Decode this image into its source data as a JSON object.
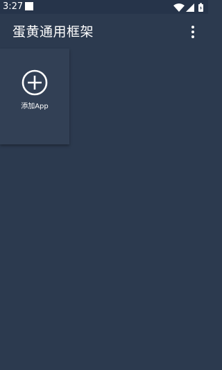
{
  "status_bar": {
    "time": "3:27",
    "icons": [
      "notification-square-icon",
      "wifi-icon",
      "signal-icon",
      "battery-charging-icon"
    ]
  },
  "app_bar": {
    "title": "蛋黄通用框架",
    "menu_icon": "more-vert-icon"
  },
  "main": {
    "add_app_card": {
      "icon": "add-circle-icon",
      "label": "添加App"
    }
  },
  "colors": {
    "background": "#2c3a4f",
    "card": "#324055",
    "text": "#ffffff"
  }
}
